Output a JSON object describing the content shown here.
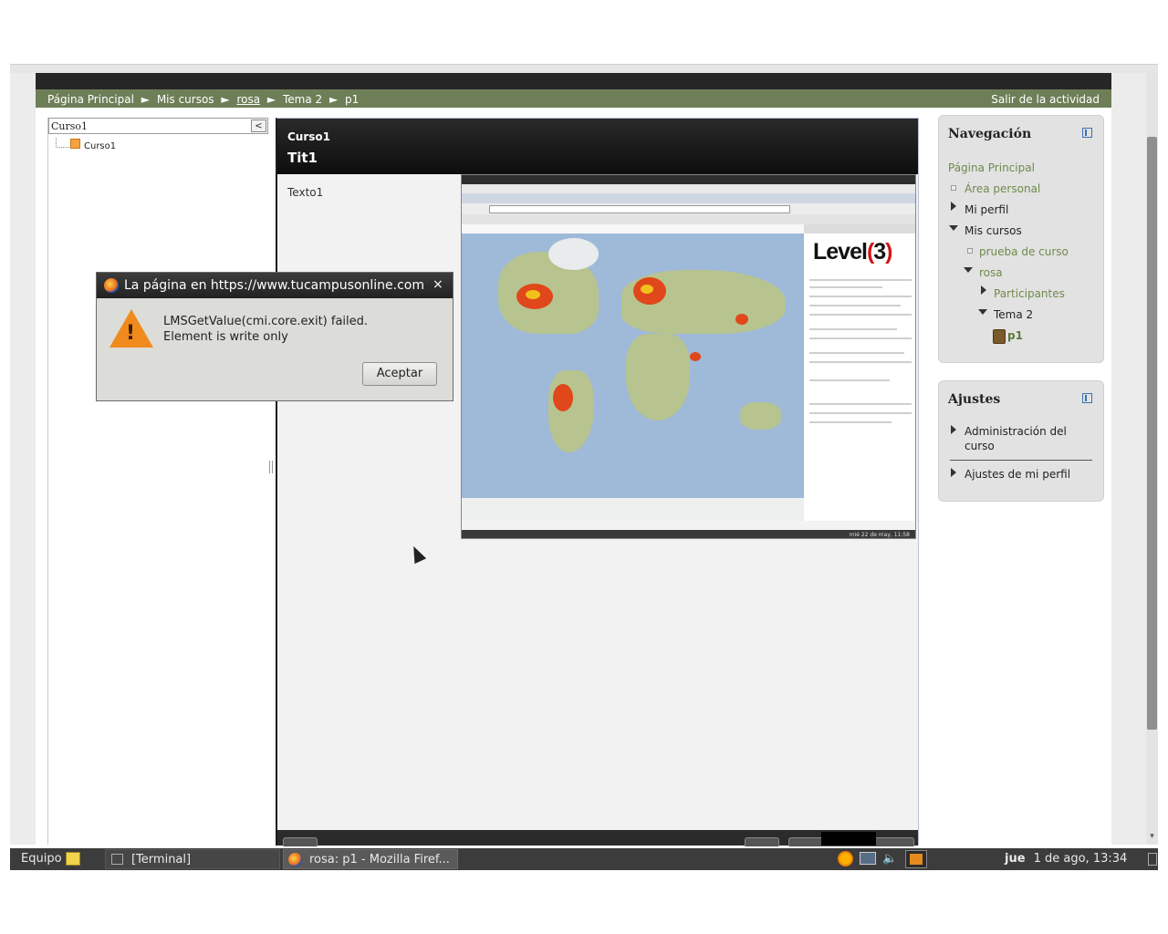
{
  "navbar": {
    "breadcrumb": [
      "Página Principal",
      "Mis cursos",
      "rosa",
      "Tema 2",
      "p1"
    ],
    "separator": "►",
    "exit_label": "Salir de la actividad"
  },
  "toc": {
    "title": "Curso1",
    "collapse_glyph": "<",
    "item_label": "Curso1"
  },
  "content": {
    "course_name": "Curso1",
    "lesson_title": "Tit1",
    "text": "Texto1"
  },
  "embedded_screenshot": {
    "logo_text": "Level",
    "logo_number": "3",
    "logo_paren_left": "(",
    "logo_paren_right": ")",
    "taskbar_time": "mié 22 de may, 11:58"
  },
  "navigation_block": {
    "title": "Navegación",
    "items": {
      "home": "Página Principal",
      "personal_area": "Área personal",
      "profile": "Mi perfil",
      "my_courses": "Mis cursos",
      "course_test": "prueba de curso",
      "course_rosa": "rosa",
      "participants": "Participantes",
      "topic2": "Tema 2",
      "p1": "p1"
    }
  },
  "settings_block": {
    "title": "Ajustes",
    "items": {
      "course_admin_line1": "Administración del",
      "course_admin_line2": "curso",
      "profile_settings": "Ajustes de mi perfil"
    }
  },
  "dialog": {
    "title": "La página en https://www.tucampusonline.com",
    "close_glyph": "×",
    "warning_glyph": "!",
    "message_line1": "LMSGetValue(cmi.core.exit) failed.",
    "message_line2": "Element is write only",
    "ok_label": "Aceptar"
  },
  "taskbar": {
    "equipo_label": "Equipo",
    "terminal_label": "[Terminal]",
    "firefox_label": "rosa: p1 - Mozilla Firef...",
    "volume_glyph": "🔈",
    "clock_day": "jue",
    "clock_rest": "1 de ago, 13:34"
  },
  "colors": {
    "navbar": "#6e7f58",
    "link": "#6f8a4c",
    "dialog_bg": "#dcdcd8",
    "taskbar": "#3c3c3c"
  }
}
